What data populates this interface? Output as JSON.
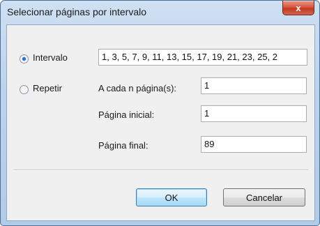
{
  "dialog": {
    "title": "Selecionar páginas por intervalo",
    "close_glyph": "x"
  },
  "interval": {
    "label": "Intervalo",
    "selected": true,
    "value": "1, 3, 5, 7, 9, 11, 13, 15, 17, 19, 21, 23, 25, 2"
  },
  "repeat": {
    "label": "Repetir",
    "selected": false,
    "every_n_label": "A cada n página(s):",
    "every_n_value": "1",
    "start_label": "Página inicial:",
    "start_value": "1",
    "end_label": "Página final:",
    "end_value": "89"
  },
  "buttons": {
    "ok": "OK",
    "cancel": "Cancelar"
  },
  "colors": {
    "accent": "#2c74c9",
    "close_button": "#c23b22"
  }
}
